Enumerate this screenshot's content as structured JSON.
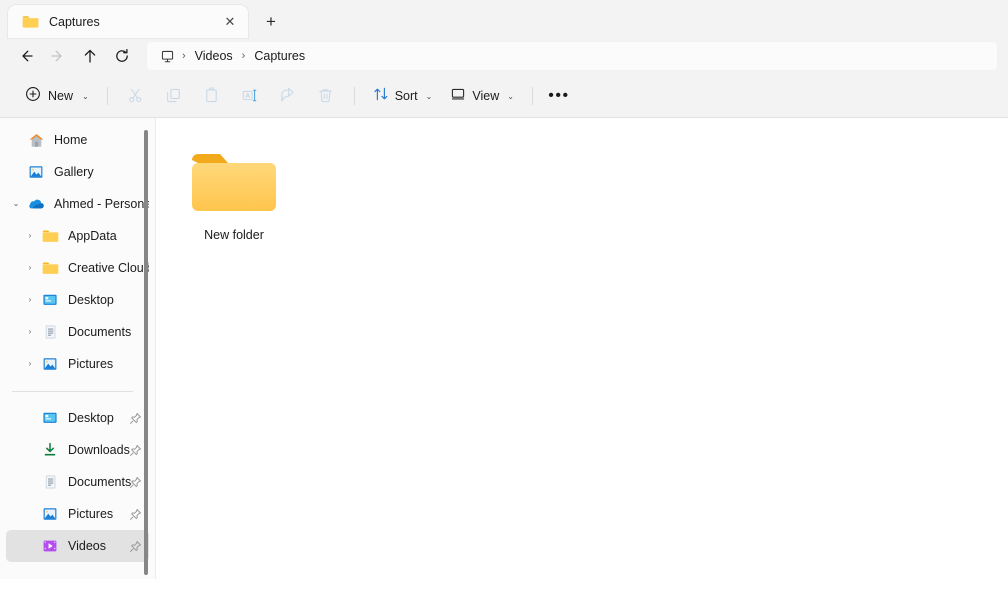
{
  "window": {
    "tab": {
      "title": "Captures",
      "icon": "folder-icon",
      "close_label": "✕",
      "new_tab_label": "+"
    }
  },
  "navbar": {
    "back_label": "back-arrow",
    "forward_label": "forward-arrow",
    "up_label": "up-arrow",
    "refresh_label": "refresh",
    "breadcrumb": {
      "root_icon": "this-pc-monitor-icon",
      "separator": "›",
      "items": [
        {
          "label": "Videos"
        },
        {
          "label": "Captures"
        }
      ]
    }
  },
  "toolbar": {
    "new_label": "New",
    "new_icon": "circle-plus-icon",
    "chevron": "⌄",
    "actions": [
      {
        "name": "cut",
        "icon": "scissors-icon",
        "enabled": false
      },
      {
        "name": "copy",
        "icon": "copy-icon",
        "enabled": false
      },
      {
        "name": "paste",
        "icon": "clipboard-paste-icon",
        "enabled": false
      },
      {
        "name": "rename",
        "icon": "rename-icon",
        "enabled": false
      },
      {
        "name": "share",
        "icon": "share-icon",
        "enabled": false
      },
      {
        "name": "delete",
        "icon": "trash-icon",
        "enabled": false
      }
    ],
    "sort_label": "Sort",
    "sort_icon": "sort-arrows-icon",
    "view_label": "View",
    "view_icon": "view-monitor-icon",
    "more_label": "•••"
  },
  "sidebar": {
    "primary": [
      {
        "label": "Home",
        "icon": "home-icon",
        "chevron": "",
        "indent": 0,
        "selected": false,
        "pinned": false
      },
      {
        "label": "Gallery",
        "icon": "gallery-icon",
        "chevron": "",
        "indent": 0,
        "selected": false,
        "pinned": false
      },
      {
        "label": "Ahmed - Personal",
        "icon": "onedrive-cloud-icon",
        "chevron": "⌄",
        "indent": 0,
        "selected": false,
        "pinned": false
      },
      {
        "label": "AppData",
        "icon": "folder-icon",
        "chevron": "›",
        "indent": 1,
        "selected": false,
        "pinned": false
      },
      {
        "label": "Creative Cloud Files",
        "icon": "folder-icon",
        "chevron": "›",
        "indent": 1,
        "selected": false,
        "pinned": false
      },
      {
        "label": "Desktop",
        "icon": "desktop-icon",
        "chevron": "›",
        "indent": 1,
        "selected": false,
        "pinned": false
      },
      {
        "label": "Documents",
        "icon": "documents-icon",
        "chevron": "›",
        "indent": 1,
        "selected": false,
        "pinned": false
      },
      {
        "label": "Pictures",
        "icon": "pictures-icon",
        "chevron": "›",
        "indent": 1,
        "selected": false,
        "pinned": false
      }
    ],
    "secondary": [
      {
        "label": "Desktop",
        "icon": "desktop-icon",
        "chevron": "",
        "indent": 1,
        "selected": false,
        "pinned": true
      },
      {
        "label": "Downloads",
        "icon": "downloads-icon",
        "chevron": "",
        "indent": 1,
        "selected": false,
        "pinned": true
      },
      {
        "label": "Documents",
        "icon": "documents-icon",
        "chevron": "",
        "indent": 1,
        "selected": false,
        "pinned": true
      },
      {
        "label": "Pictures",
        "icon": "pictures-icon",
        "chevron": "",
        "indent": 1,
        "selected": false,
        "pinned": true
      },
      {
        "label": "Videos",
        "icon": "videos-icon",
        "chevron": "",
        "indent": 1,
        "selected": true,
        "pinned": true
      }
    ]
  },
  "content": {
    "items": [
      {
        "name": "New folder",
        "icon": "folder-icon",
        "type": "folder"
      }
    ]
  },
  "colors": {
    "chrome": "#f3f3f3",
    "surface": "#fbfbfb",
    "content": "#ffffff",
    "selection": "#e2e2e2",
    "folder_yellow": "#ffd166",
    "folder_yellow_dark": "#f5b816",
    "accent_blue": "#0078d4",
    "text": "#1b1b1b",
    "disabled": "#c8d8e6"
  }
}
